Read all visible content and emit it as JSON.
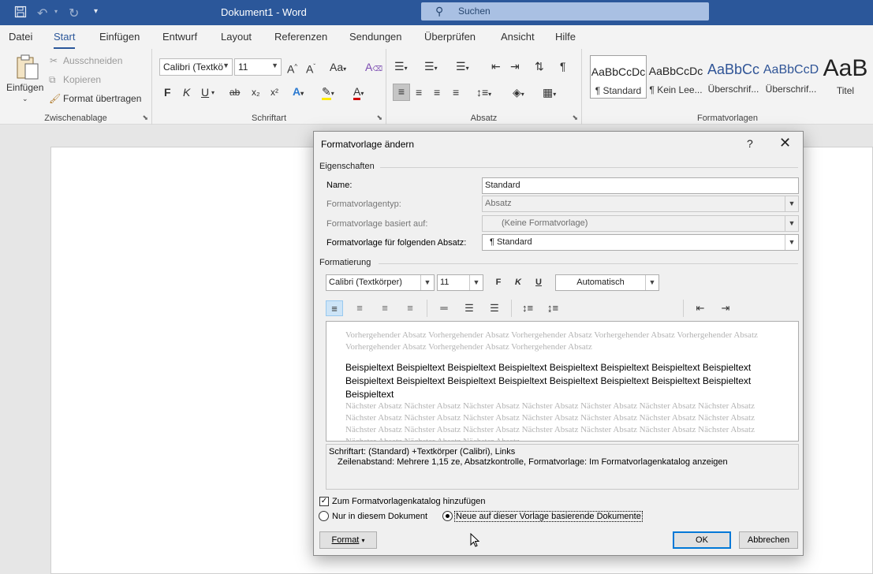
{
  "window": {
    "title": "Dokument1 - Word",
    "search_placeholder": "Suchen"
  },
  "quick_access": {
    "save_icon": "save-icon",
    "undo_icon": "undo-icon",
    "redo_icon": "redo-icon",
    "customize_icon": "customize-icon"
  },
  "tabs": [
    "Datei",
    "Start",
    "Einfügen",
    "Entwurf",
    "Layout",
    "Referenzen",
    "Sendungen",
    "Überprüfen",
    "Ansicht",
    "Hilfe"
  ],
  "active_tab": "Start",
  "ribbon": {
    "clipboard": {
      "paste": "Einfügen",
      "cut": "Ausschneiden",
      "copy": "Kopieren",
      "format_painter": "Format übertragen",
      "label": "Zwischenablage"
    },
    "font": {
      "font_name": "Calibri (Textkö",
      "font_size": "11",
      "label": "Schriftart",
      "bold": "F",
      "italic": "K",
      "underline": "U",
      "strike": "ab",
      "sub": "x₂",
      "sup": "x²",
      "grow": "A^",
      "shrink": "Aˇ",
      "case": "Aa"
    },
    "paragraph": {
      "label": "Absatz",
      "pilcrow": "¶"
    },
    "styles": {
      "label": "Formatvorlagen",
      "items": [
        {
          "preview": "AaBbCcDc",
          "name": "¶ Standard"
        },
        {
          "preview": "AaBbCcDc",
          "name": "¶ Kein Lee..."
        },
        {
          "preview": "AaBbCc",
          "name": "Überschrif..."
        },
        {
          "preview": "AaBbCcD",
          "name": "Überschrif..."
        },
        {
          "preview": "AaB",
          "name": "Titel"
        }
      ]
    }
  },
  "dialog": {
    "title": "Formatvorlage ändern",
    "help": "?",
    "close": "✕",
    "properties_label": "Eigenschaften",
    "name_label": "Name:",
    "name_value": "Standard",
    "type_label": "Formatvorlagentyp:",
    "type_value": "Absatz",
    "based_label": "Formatvorlage basiert auf:",
    "based_value": "(Keine Formatvorlage)",
    "next_label": "Formatvorlage für folgenden Absatz:",
    "next_value": "¶  Standard",
    "formatting_label": "Formatierung",
    "font": "Calibri (Textkörper)",
    "size": "11",
    "bold": "F",
    "italic": "K",
    "underline": "U",
    "color": "Automatisch",
    "preview_prev": "Vorhergehender Absatz Vorhergehender Absatz Vorhergehender Absatz Vorhergehender Absatz Vorhergehender Absatz Vorhergehender Absatz Vorhergehender Absatz Vorhergehender Absatz",
    "preview_main": "Beispieltext Beispieltext Beispieltext Beispieltext Beispieltext Beispieltext Beispieltext Beispieltext Beispieltext Beispieltext Beispieltext Beispieltext Beispieltext Beispieltext Beispieltext Beispieltext Beispieltext",
    "preview_next": "Nächster Absatz Nächster Absatz Nächster Absatz Nächster Absatz Nächster Absatz Nächster Absatz Nächster Absatz Nächster Absatz Nächster Absatz Nächster Absatz Nächster Absatz Nächster Absatz Nächster Absatz Nächster Absatz Nächster Absatz Nächster Absatz Nächster Absatz Nächster Absatz Nächster Absatz Nächster Absatz Nächster Absatz Nächster Absatz Nächster Absatz Nächster Absatz",
    "description_line1": "Schriftart: (Standard) +Textkörper (Calibri), Links",
    "description_line2": "Zeilenabstand:  Mehrere 1,15 ze, Absatzkontrolle, Formatvorlage: Im Formatvorlagenkatalog anzeigen",
    "add_to_gallery": "Zum Formatvorlagenkatalog hinzufügen",
    "add_to_gallery_checked": true,
    "only_this_doc": "Nur in diesem Dokument",
    "new_docs": "Neue auf dieser Vorlage basierende Dokumente",
    "selected_scope": "Neue auf dieser Vorlage basierende Dokumente",
    "format_button": "Format",
    "ok": "OK",
    "cancel": "Abbrechen"
  },
  "colors": {
    "title_bar": "#2b579a",
    "accent": "#2b579a",
    "dialog_bg": "#f0f0f0",
    "default_button_border": "#0078d7"
  }
}
